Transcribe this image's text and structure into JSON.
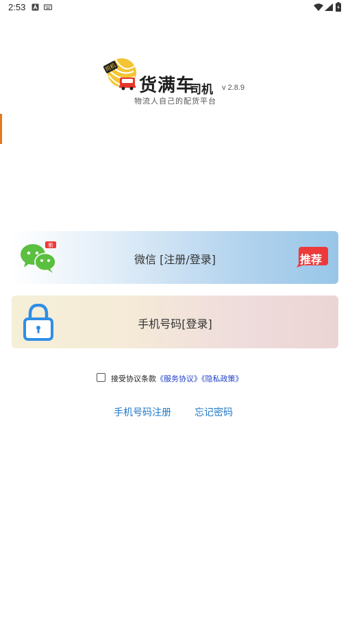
{
  "status_bar": {
    "time": "2:53"
  },
  "logo": {
    "emblem_badge": "司机",
    "title": "货满车",
    "subtitle": "司机",
    "version": "v 2.8.9",
    "slogan": "物流人自己的配货平台"
  },
  "login": {
    "wechat": {
      "label": "微信 [注册/登录]",
      "badge_new": "新",
      "badge_recommend": "推荐"
    },
    "phone": {
      "label": "手机号码[登录]"
    }
  },
  "agreement": {
    "checked": false,
    "prefix": "接受协议条款",
    "service_link": "《服务协议》",
    "privacy_link": "《隐私政策》"
  },
  "links": {
    "register": "手机号码注册",
    "forgot": "忘记密码"
  },
  "colors": {
    "link": "#1f78c9",
    "agreement_link": "#1e3fc8",
    "wechat_green": "#5bbf3f",
    "lock_blue": "#2f8ee6",
    "recommend_red": "#ec3a3a",
    "logo_yellow": "#f3c534",
    "truck_red": "#e7362b"
  },
  "icons": {
    "wechat": "wechat-icon",
    "lock": "lock-icon"
  }
}
